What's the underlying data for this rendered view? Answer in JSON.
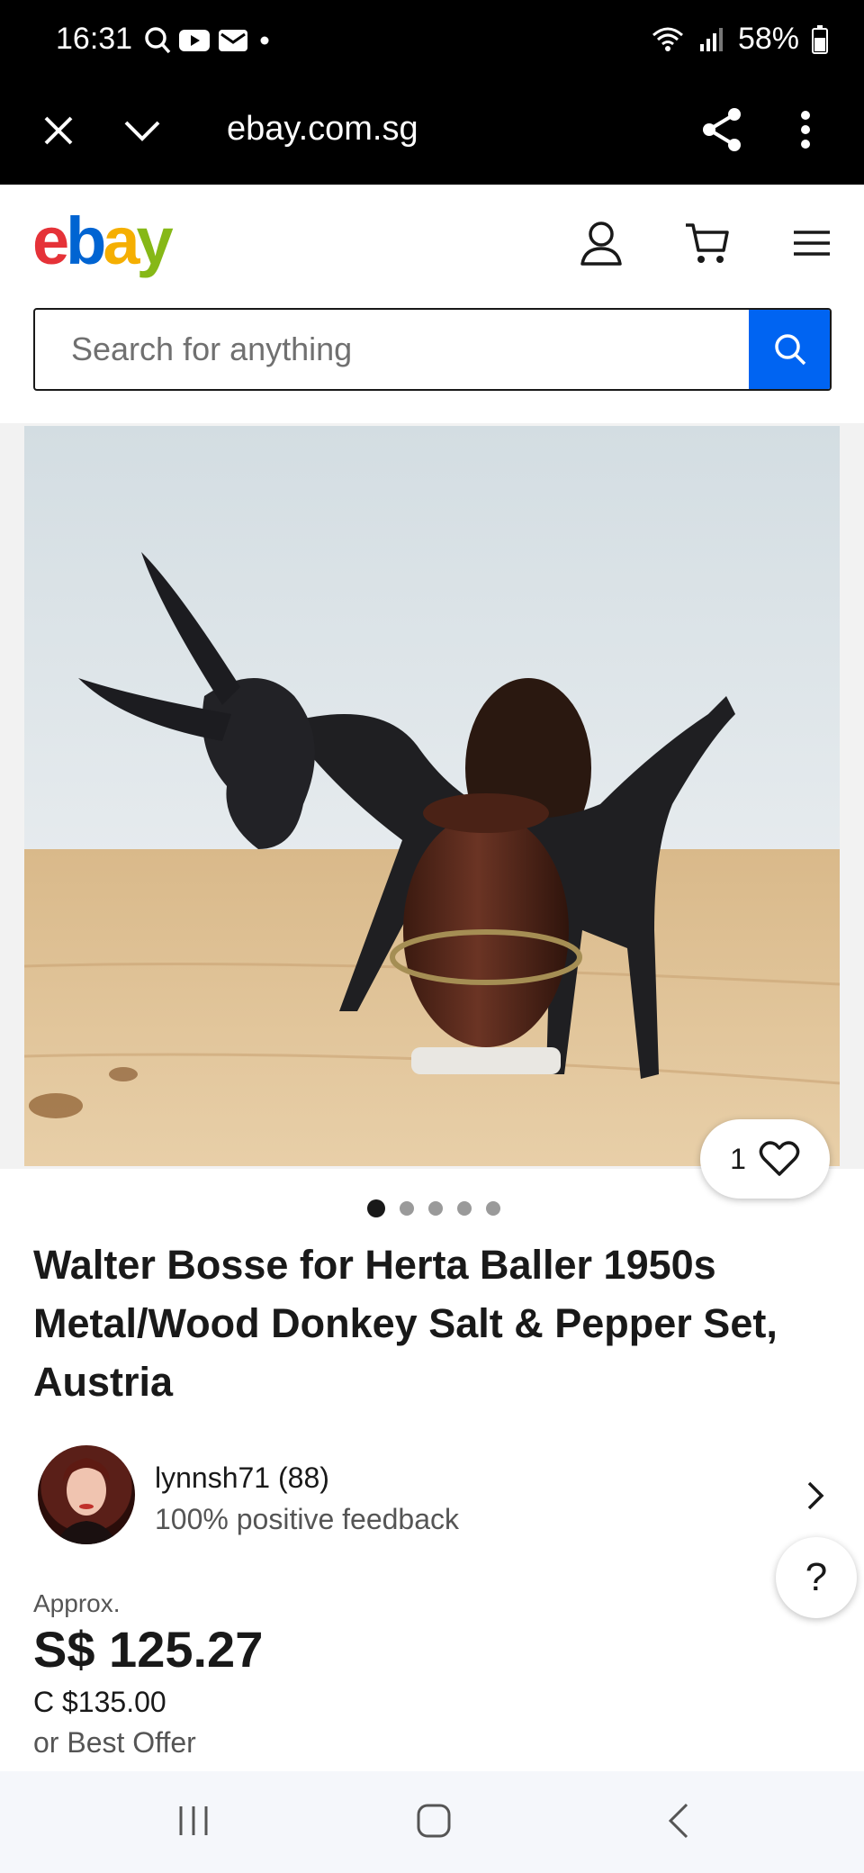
{
  "status_bar": {
    "time": "16:31",
    "battery": "58%",
    "icons": [
      "search-icon",
      "youtube-icon",
      "mail-icon",
      "dot-icon",
      "wifi-icon",
      "signal-icon",
      "battery-icon"
    ]
  },
  "browser": {
    "url": "ebay.com.sg",
    "icons": [
      "close-icon",
      "chevron-down-icon",
      "share-icon",
      "more-vert-icon"
    ]
  },
  "header": {
    "logo_letters": [
      "e",
      "b",
      "a",
      "y"
    ],
    "logo_colors": [
      "#e53238",
      "#0064d2",
      "#f5af02",
      "#86b817"
    ],
    "icons": [
      "account-icon",
      "cart-icon",
      "menu-icon"
    ]
  },
  "search": {
    "placeholder": "Search for anything",
    "accent": "#0064f2"
  },
  "gallery": {
    "watch_count": "1",
    "total_images": 5,
    "active_index": 0
  },
  "listing": {
    "title": "Walter Bosse for Herta Baller 1950s Metal/Wood Donkey Salt & Pepper Set, Austria",
    "seller": {
      "name": "lynnsh71 (88)",
      "feedback": "100% positive feedback"
    },
    "help_label": "?",
    "approx_label": "Approx.",
    "price": "S$ 125.27",
    "original_price": "C $135.00",
    "best_offer": "or Best Offer"
  },
  "nav_bar": {
    "icons": [
      "recent-apps-icon",
      "home-icon",
      "back-icon"
    ]
  }
}
